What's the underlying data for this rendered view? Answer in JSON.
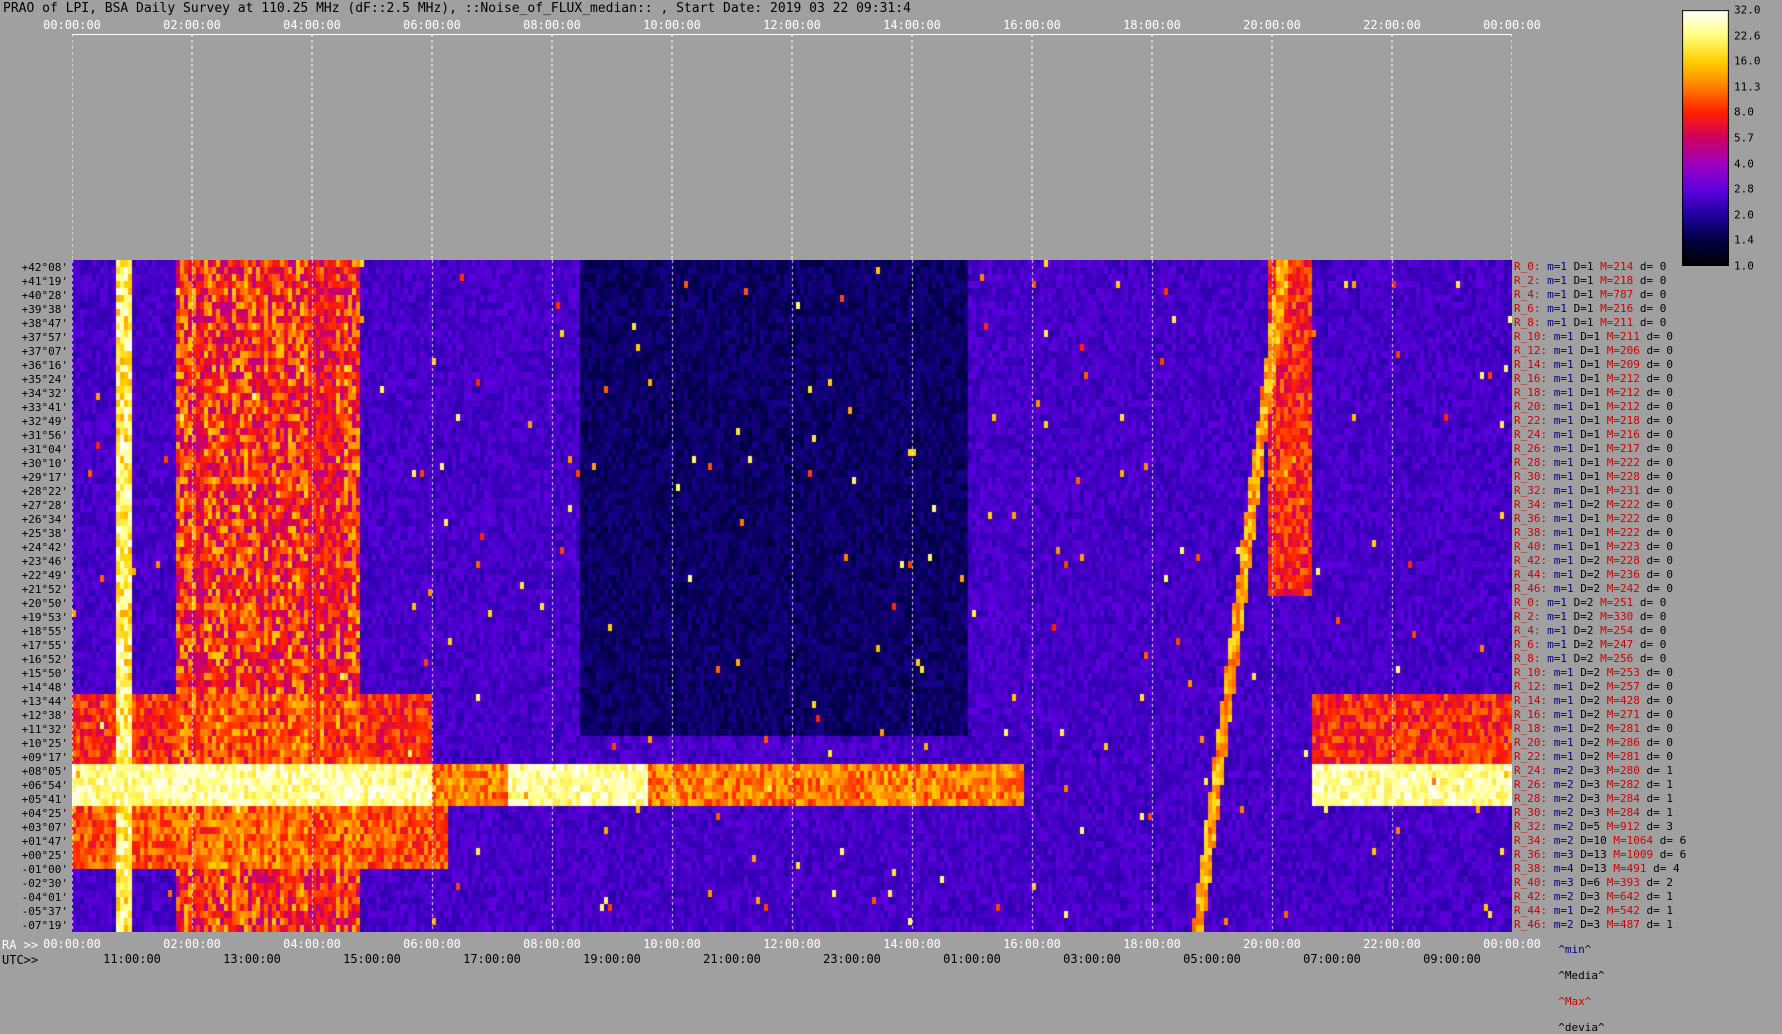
{
  "title": "PRAO of LPI, BSA Daily Survey at 110.25 MHz (dF::2.5 MHz), ::Noise_of_FLUX_median:: , Start Date: 2019 03 22 09:31:4",
  "chart_data": {
    "type": "heatmap",
    "title": "PRAO of LPI, BSA Daily Survey at 110.25 MHz (dF::2.5 MHz), ::Noise_of_FLUX_median:: , Start Date: 2019 03 22 09:31:4",
    "top_ticks": [
      "00:00:00",
      "02:00:00",
      "04:00:00",
      "06:00:00",
      "08:00:00",
      "10:00:00",
      "12:00:00",
      "14:00:00",
      "16:00:00",
      "18:00:00",
      "20:00:00",
      "22:00:00",
      "00:00:00"
    ],
    "ra_label": "RA >>",
    "ra_ticks": [
      "00:00:00",
      "02:00:00",
      "04:00:00",
      "06:00:00",
      "08:00:00",
      "10:00:00",
      "12:00:00",
      "14:00:00",
      "16:00:00",
      "18:00:00",
      "20:00:00",
      "22:00:00",
      "00:00:00"
    ],
    "utc_label": "UTC>>",
    "utc_ticks": [
      "11:00:00",
      "13:00:00",
      "15:00:00",
      "17:00:00",
      "19:00:00",
      "21:00:00",
      "23:00:00",
      "01:00:00",
      "03:00:00",
      "05:00:00",
      "07:00:00",
      "09:00:00"
    ],
    "dec_labels": [
      "+42°08'",
      "+41°19'",
      "+40°28'",
      "+39°38'",
      "+38°47'",
      "+37°57'",
      "+37°07'",
      "+36°16'",
      "+35°24'",
      "+34°32'",
      "+33°41'",
      "+32°49'",
      "+31°56'",
      "+31°04'",
      "+30°10'",
      "+29°17'",
      "+28°22'",
      "+27°28'",
      "+26°34'",
      "+25°38'",
      "+24°42'",
      "+23°46'",
      "+22°49'",
      "+21°52'",
      "+20°50'",
      "+19°53'",
      "+18°55'",
      "+17°55'",
      "+16°52'",
      "+15°50'",
      "+14°48'",
      "+13°44'",
      "+12°38'",
      "+11°32'",
      "+10°25'",
      "+09°17'",
      "+08°05'",
      "+06°54'",
      "+05°41'",
      "+04°25'",
      "+03°07'",
      "+01°47'",
      "+00°25'",
      "-01°00'",
      "-02°30'",
      "-04°01'",
      "-05°37'",
      "-07°19'"
    ],
    "colorbar": {
      "ticks": [
        "32.0",
        "22.6",
        "16.0",
        "11.3",
        "8.0",
        "5.7",
        "4.0",
        "2.8",
        "2.0",
        "1.4",
        "1.0"
      ],
      "colors": [
        "#ffffff",
        "#ffff80",
        "#ffd000",
        "#ff8000",
        "#ff2000",
        "#d00060",
        "#a000c0",
        "#6000e0",
        "#2000a0",
        "#000040",
        "#000000"
      ]
    },
    "rows_stats": [
      {
        "r": "R_0:",
        "m": "m=1",
        "d": "D=1",
        "M": "M=214",
        "dv": "d= 0"
      },
      {
        "r": "R_2:",
        "m": "m=1",
        "d": "D=1",
        "M": "M=218",
        "dv": "d= 0"
      },
      {
        "r": "R_4:",
        "m": "m=1",
        "d": "D=1",
        "M": "M=787",
        "dv": "d= 0"
      },
      {
        "r": "R_6:",
        "m": "m=1",
        "d": "D=1",
        "M": "M=216",
        "dv": "d= 0"
      },
      {
        "r": "R_8:",
        "m": "m=1",
        "d": "D=1",
        "M": "M=211",
        "dv": "d= 0"
      },
      {
        "r": "R_10:",
        "m": "m=1",
        "d": "D=1",
        "M": "M=211",
        "dv": "d= 0"
      },
      {
        "r": "R_12:",
        "m": "m=1",
        "d": "D=1",
        "M": "M=206",
        "dv": "d= 0"
      },
      {
        "r": "R_14:",
        "m": "m=1",
        "d": "D=1",
        "M": "M=209",
        "dv": "d= 0"
      },
      {
        "r": "R_16:",
        "m": "m=1",
        "d": "D=1",
        "M": "M=212",
        "dv": "d= 0"
      },
      {
        "r": "R_18:",
        "m": "m=1",
        "d": "D=1",
        "M": "M=212",
        "dv": "d= 0"
      },
      {
        "r": "R_20:",
        "m": "m=1",
        "d": "D=1",
        "M": "M=212",
        "dv": "d= 0"
      },
      {
        "r": "R_22:",
        "m": "m=1",
        "d": "D=1",
        "M": "M=218",
        "dv": "d= 0"
      },
      {
        "r": "R_24:",
        "m": "m=1",
        "d": "D=1",
        "M": "M=216",
        "dv": "d= 0"
      },
      {
        "r": "R_26:",
        "m": "m=1",
        "d": "D=1",
        "M": "M=217",
        "dv": "d= 0"
      },
      {
        "r": "R_28:",
        "m": "m=1",
        "d": "D=1",
        "M": "M=222",
        "dv": "d= 0"
      },
      {
        "r": "R_30:",
        "m": "m=1",
        "d": "D=1",
        "M": "M=228",
        "dv": "d= 0"
      },
      {
        "r": "R_32:",
        "m": "m=1",
        "d": "D=1",
        "M": "M=231",
        "dv": "d= 0"
      },
      {
        "r": "R_34:",
        "m": "m=1",
        "d": "D=2",
        "M": "M=222",
        "dv": "d= 0"
      },
      {
        "r": "R_36:",
        "m": "m=1",
        "d": "D=1",
        "M": "M=222",
        "dv": "d= 0"
      },
      {
        "r": "R_38:",
        "m": "m=1",
        "d": "D=1",
        "M": "M=222",
        "dv": "d= 0"
      },
      {
        "r": "R_40:",
        "m": "m=1",
        "d": "D=1",
        "M": "M=223",
        "dv": "d= 0"
      },
      {
        "r": "R_42:",
        "m": "m=1",
        "d": "D=2",
        "M": "M=228",
        "dv": "d= 0"
      },
      {
        "r": "R_44:",
        "m": "m=1",
        "d": "D=2",
        "M": "M=236",
        "dv": "d= 0"
      },
      {
        "r": "R_46:",
        "m": "m=1",
        "d": "D=2",
        "M": "M=242",
        "dv": "d= 0"
      },
      {
        "r": "R_0:",
        "m": "m=1",
        "d": "D=2",
        "M": "M=251",
        "dv": "d= 0"
      },
      {
        "r": "R_2:",
        "m": "m=1",
        "d": "D=2",
        "M": "M=330",
        "dv": "d= 0"
      },
      {
        "r": "R_4:",
        "m": "m=1",
        "d": "D=2",
        "M": "M=254",
        "dv": "d= 0"
      },
      {
        "r": "R_6:",
        "m": "m=1",
        "d": "D=2",
        "M": "M=247",
        "dv": "d= 0"
      },
      {
        "r": "R_8:",
        "m": "m=1",
        "d": "D=2",
        "M": "M=256",
        "dv": "d= 0"
      },
      {
        "r": "R_10:",
        "m": "m=1",
        "d": "D=2",
        "M": "M=253",
        "dv": "d= 0"
      },
      {
        "r": "R_12:",
        "m": "m=1",
        "d": "D=2",
        "M": "M=257",
        "dv": "d= 0"
      },
      {
        "r": "R_14:",
        "m": "m=1",
        "d": "D=2",
        "M": "M=428",
        "dv": "d= 0"
      },
      {
        "r": "R_16:",
        "m": "m=1",
        "d": "D=2",
        "M": "M=271",
        "dv": "d= 0"
      },
      {
        "r": "R_18:",
        "m": "m=1",
        "d": "D=2",
        "M": "M=281",
        "dv": "d= 0"
      },
      {
        "r": "R_20:",
        "m": "m=1",
        "d": "D=2",
        "M": "M=286",
        "dv": "d= 0"
      },
      {
        "r": "R_22:",
        "m": "m=1",
        "d": "D=2",
        "M": "M=281",
        "dv": "d= 0"
      },
      {
        "r": "R_24:",
        "m": "m=2",
        "d": "D=3",
        "M": "M=280",
        "dv": "d= 1"
      },
      {
        "r": "R_26:",
        "m": "m=2",
        "d": "D=3",
        "M": "M=282",
        "dv": "d= 1"
      },
      {
        "r": "R_28:",
        "m": "m=2",
        "d": "D=3",
        "M": "M=284",
        "dv": "d= 1"
      },
      {
        "r": "R_30:",
        "m": "m=2",
        "d": "D=3",
        "M": "M=284",
        "dv": "d= 1"
      },
      {
        "r": "R_32:",
        "m": "m=2",
        "d": "D=5",
        "M": "M=912",
        "dv": "d= 3"
      },
      {
        "r": "R_34:",
        "m": "m=2",
        "d": "D=10",
        "M": "M=1064",
        "dv": "d= 6"
      },
      {
        "r": "R_36:",
        "m": "m=3",
        "d": "D=13",
        "M": "M=1009",
        "dv": "d= 6"
      },
      {
        "r": "R_38:",
        "m": "m=4",
        "d": "D=13",
        "M": "M=491",
        "dv": "d= 4"
      },
      {
        "r": "R_40:",
        "m": "m=3",
        "d": "D=6",
        "M": "M=393",
        "dv": "d= 2"
      },
      {
        "r": "R_42:",
        "m": "m=2",
        "d": "D=3",
        "M": "M=642",
        "dv": "d= 1"
      },
      {
        "r": "R_44:",
        "m": "m=1",
        "d": "D=2",
        "M": "M=542",
        "dv": "d= 1"
      },
      {
        "r": "R_46:",
        "m": "m=2",
        "d": "D=3",
        "M": "M=487",
        "dv": "d= 1"
      }
    ],
    "legend": {
      "min": "^min^",
      "median": "^Media^",
      "max": "^Max^",
      "devia": "^devia^"
    },
    "colors": {
      "min": "#000080",
      "median": "#000000",
      "max": "#d00000",
      "devia": "#000000"
    }
  }
}
